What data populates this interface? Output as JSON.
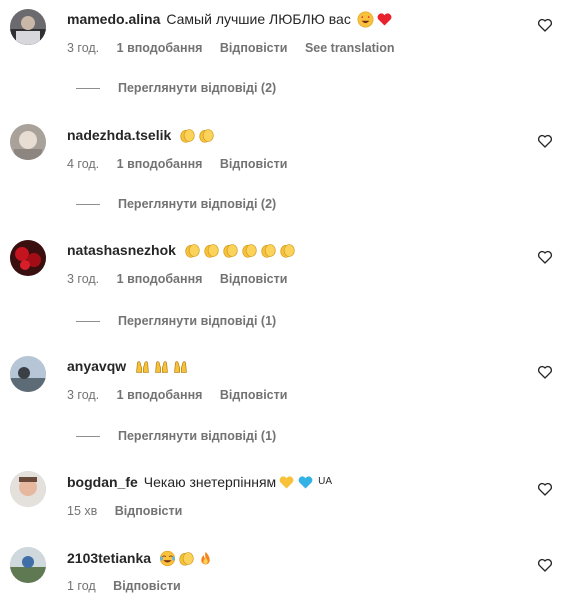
{
  "comments": [
    {
      "username": "mamedo.alina",
      "text": "Самый лучшие ЛЮБЛЮ вас",
      "emojis": [
        "star-struck-emoji",
        "red-heart-emoji"
      ],
      "time": "3 год.",
      "likes": "1 вподобання",
      "reply_label": "Відповісти",
      "translate_label": "See translation",
      "view_replies": "Переглянути відповіді (2)"
    },
    {
      "username": "nadezhda.tselik",
      "text": "",
      "emojis": [
        "clapping-hands-emoji",
        "clapping-hands-emoji"
      ],
      "time": "4 год.",
      "likes": "1 вподобання",
      "reply_label": "Відповісти",
      "view_replies": "Переглянути відповіді (2)"
    },
    {
      "username": "natashasnezhok",
      "text": "",
      "emojis": [
        "clapping-hands-emoji",
        "clapping-hands-emoji",
        "clapping-hands-emoji",
        "clapping-hands-emoji",
        "clapping-hands-emoji",
        "clapping-hands-emoji"
      ],
      "time": "3 год.",
      "likes": "1 вподобання",
      "reply_label": "Відповісти",
      "view_replies": "Переглянути відповіді (1)"
    },
    {
      "username": "anyavqw",
      "text": "",
      "emojis": [
        "praising-hands-emoji",
        "praising-hands-emoji",
        "praising-hands-emoji"
      ],
      "time": "3 год.",
      "likes": "1 вподобання",
      "reply_label": "Відповісти",
      "view_replies": "Переглянути відповіді (1)"
    },
    {
      "username": "bogdan_fe",
      "text": "Чекаю знетерпінням",
      "emojis": [
        "yellow-heart-emoji",
        "blue-heart-emoji"
      ],
      "suffix": "UA",
      "time": "15 хв",
      "reply_label": "Відповісти"
    },
    {
      "username": "2103tetianka",
      "text": "",
      "emojis": [
        "tears-of-joy-emoji",
        "clapping-hands-emoji",
        "fire-emoji"
      ],
      "time": "1 год",
      "reply_label": "Відповісти"
    }
  ],
  "colors": {
    "text": "#262626",
    "secondary": "#737373",
    "heart_red": "#e8212c",
    "clap_yellow": "#f7c23a",
    "blue_heart": "#34b2e4"
  }
}
